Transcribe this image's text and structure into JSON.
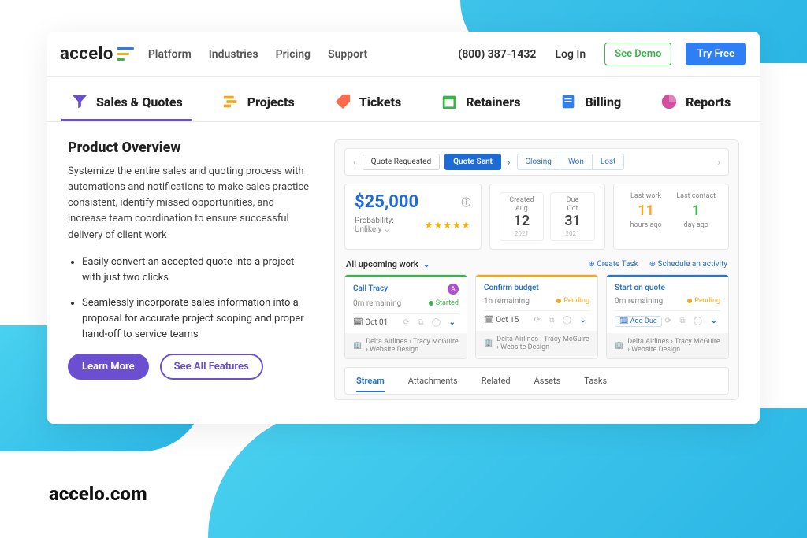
{
  "header": {
    "logo_text": "accelo",
    "nav": [
      "Platform",
      "Industries",
      "Pricing",
      "Support"
    ],
    "phone": "(800) 387-1432",
    "login": "Log In",
    "see_demo": "See Demo",
    "try_free": "Try Free"
  },
  "modules": [
    {
      "label": "Sales & Quotes",
      "active": true
    },
    {
      "label": "Projects"
    },
    {
      "label": "Tickets"
    },
    {
      "label": "Retainers"
    },
    {
      "label": "Billing"
    },
    {
      "label": "Reports"
    }
  ],
  "overview": {
    "heading": "Product Overview",
    "body": "Systemize the entire sales and quoting process with automations and notifications to make sales practice consistent, identify missed opportunities, and increase team coordination to ensure successful delivery of client work",
    "bullets": [
      "Easily convert an accepted quote into a project with just two clicks",
      "Seamlessly incorporate sales information into a proposal for accurate project scoping and proper hand-off to service teams"
    ],
    "learn_more": "Learn More",
    "see_all": "See All Features"
  },
  "app": {
    "stages": {
      "requested": "Quote Requested",
      "sent": "Quote Sent",
      "group": [
        "Closing",
        "Won",
        "Lost"
      ]
    },
    "amount": "$25,000",
    "probability_label": "Probability:",
    "probability_value": "Unlikely",
    "dates": {
      "created": {
        "label": "Created",
        "month": "Aug",
        "day": "12",
        "year": "2021"
      },
      "due": {
        "label": "Due",
        "month": "Oct",
        "day": "31",
        "year": "2021"
      }
    },
    "activity": {
      "last_work": {
        "label": "Last work",
        "value": "11",
        "unit": "hours ago"
      },
      "last_contact": {
        "label": "Last contact",
        "value": "1",
        "unit": "day ago"
      }
    },
    "work_header": {
      "title": "All upcoming work",
      "create_task": "Create Task",
      "schedule": "Schedule an activity"
    },
    "tasks": [
      {
        "title": "Call Tracy",
        "avatar": "A",
        "remaining": "0m remaining",
        "status": "Started",
        "status_class": "started",
        "due": "Oct 01",
        "meta": "Delta Airlines › Tracy McGuire › Website Design"
      },
      {
        "title": "Confirm budget",
        "remaining": "1h remaining",
        "status": "Pending",
        "status_class": "pending",
        "due": "Oct 15",
        "meta": "Delta Airlines › Tracy McGuire › Website Design"
      },
      {
        "title": "Start on quote",
        "remaining": "0m remaining",
        "status": "Pending",
        "status_class": "pending",
        "add_due": "Add Due",
        "meta": "Delta Airlines › Tracy McGuire › Website Design"
      }
    ],
    "tabs": [
      "Stream",
      "Attachments",
      "Related",
      "Assets",
      "Tasks"
    ]
  },
  "footer_url": "accelo.com"
}
